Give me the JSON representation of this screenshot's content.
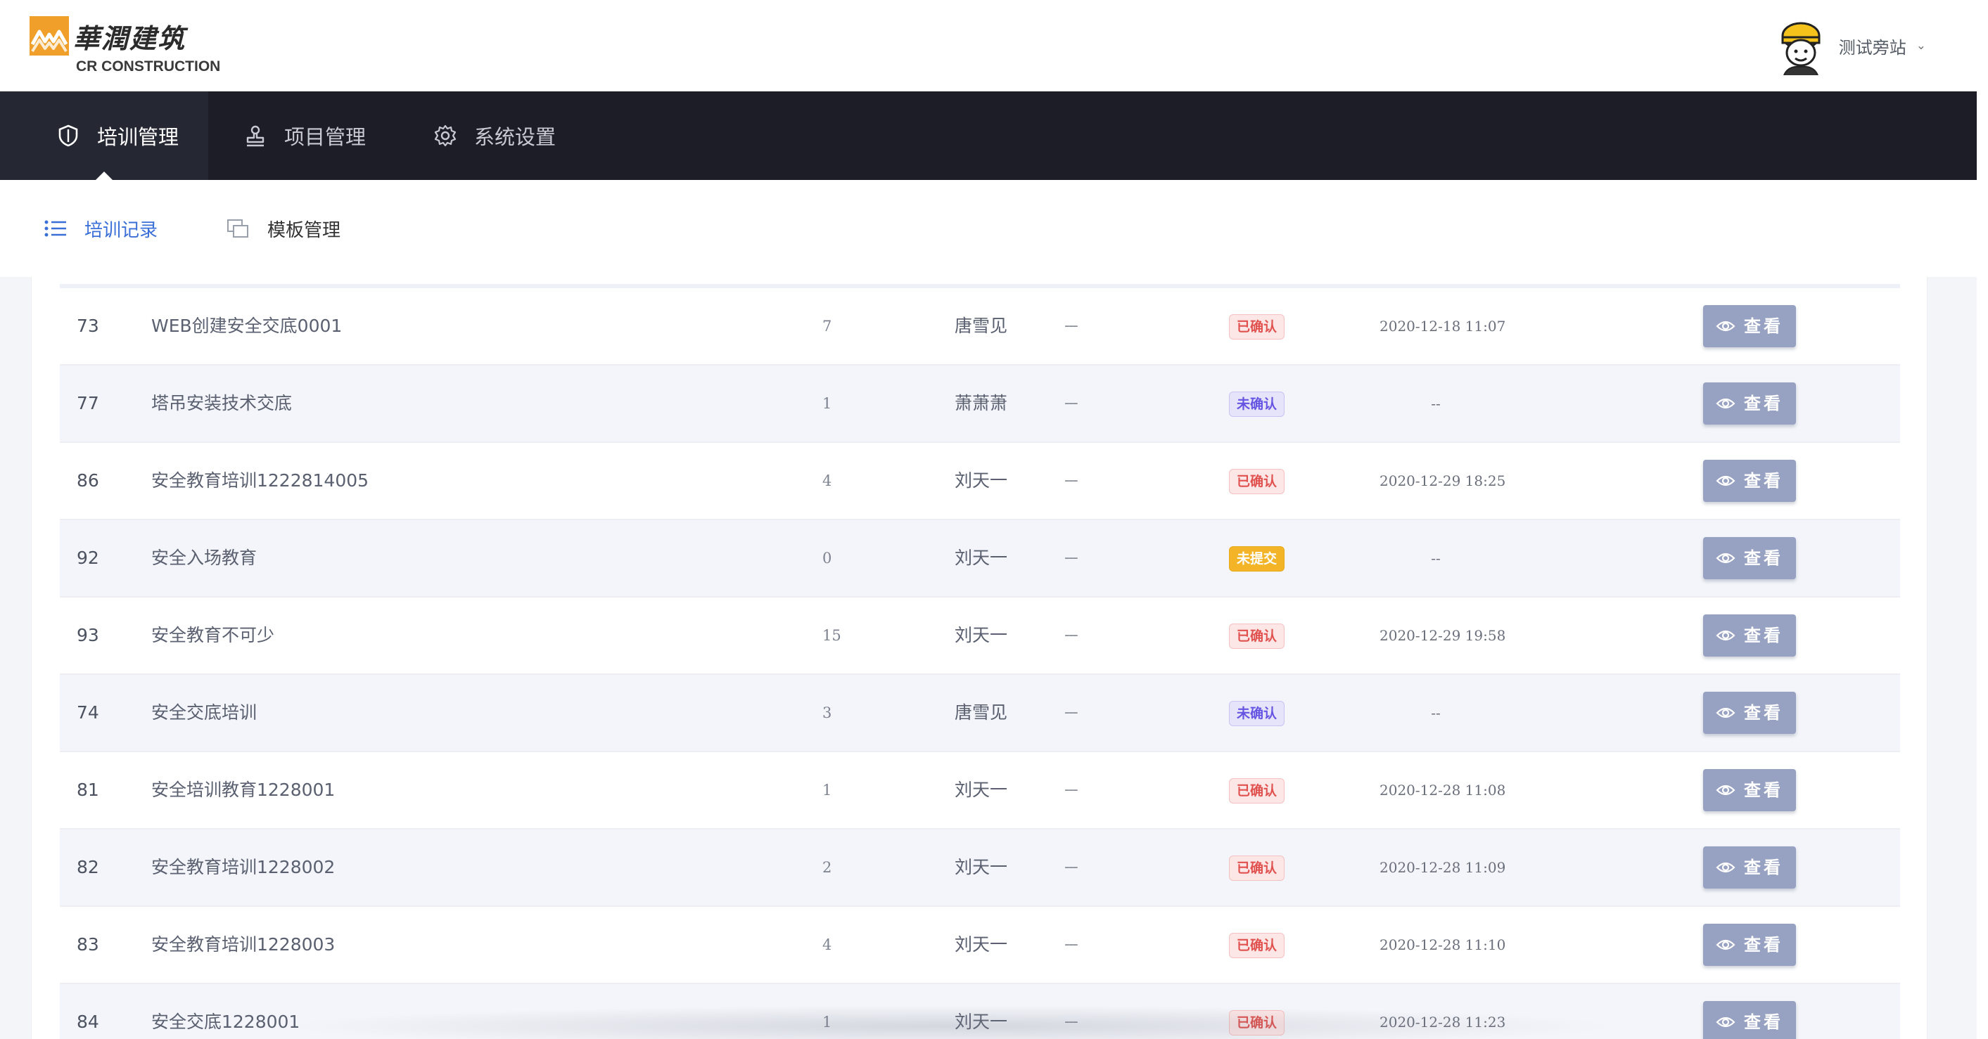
{
  "brand": {
    "name_cn": "華潤建筑",
    "name_en": "CR CONSTRUCTION",
    "color": "#f0a02a"
  },
  "user": {
    "name": "测试旁站",
    "caret": "⌄",
    "avatar_icon": "avatar-icon"
  },
  "main_nav": [
    {
      "label": "培训管理",
      "icon": "shield-icon",
      "active": true
    },
    {
      "label": "项目管理",
      "icon": "stamp-icon",
      "active": false
    },
    {
      "label": "系统设置",
      "icon": "gear-icon",
      "active": false
    }
  ],
  "sub_nav": [
    {
      "label": "培训记录",
      "icon": "list-icon",
      "active": true
    },
    {
      "label": "模板管理",
      "icon": "template-icon",
      "active": false
    }
  ],
  "colors": {
    "nav_bg": "#1c1d26",
    "accent": "#3b6fd8",
    "button": "#97a1c1"
  },
  "records": [
    {
      "id": "73",
      "name": "WEB创建安全交底0001",
      "count": "7",
      "person": "唐雪见",
      "extra": "---",
      "status": "已确认",
      "status_type": "red",
      "time": "2020-12-18 11:07",
      "action": "查看"
    },
    {
      "id": "77",
      "name": "塔吊安装技术交底",
      "count": "1",
      "person": "萧萧萧",
      "extra": "---",
      "status": "未确认",
      "status_type": "purple",
      "time": "--",
      "action": "查看"
    },
    {
      "id": "86",
      "name": "安全教育培训1222814005",
      "count": "4",
      "person": "刘天一",
      "extra": "---",
      "status": "已确认",
      "status_type": "red",
      "time": "2020-12-29 18:25",
      "action": "查看"
    },
    {
      "id": "92",
      "name": "安全入场教育",
      "count": "0",
      "person": "刘天一",
      "extra": "---",
      "status": "未提交",
      "status_type": "yellow",
      "time": "--",
      "action": "查看"
    },
    {
      "id": "93",
      "name": "安全教育不可少",
      "count": "15",
      "person": "刘天一",
      "extra": "---",
      "status": "已确认",
      "status_type": "red",
      "time": "2020-12-29 19:58",
      "action": "查看"
    },
    {
      "id": "74",
      "name": "安全交底培训",
      "count": "3",
      "person": "唐雪见",
      "extra": "---",
      "status": "未确认",
      "status_type": "purple",
      "time": "--",
      "action": "查看"
    },
    {
      "id": "81",
      "name": "安全培训教育1228001",
      "count": "1",
      "person": "刘天一",
      "extra": "---",
      "status": "已确认",
      "status_type": "red",
      "time": "2020-12-28 11:08",
      "action": "查看"
    },
    {
      "id": "82",
      "name": "安全教育培训1228002",
      "count": "2",
      "person": "刘天一",
      "extra": "---",
      "status": "已确认",
      "status_type": "red",
      "time": "2020-12-28 11:09",
      "action": "查看"
    },
    {
      "id": "83",
      "name": "安全教育培训1228003",
      "count": "4",
      "person": "刘天一",
      "extra": "---",
      "status": "已确认",
      "status_type": "red",
      "time": "2020-12-28 11:10",
      "action": "查看"
    },
    {
      "id": "84",
      "name": "安全交底1228001",
      "count": "1",
      "person": "刘天一",
      "extra": "---",
      "status": "已确认",
      "status_type": "red",
      "time": "2020-12-28 11:23",
      "action": "查看"
    }
  ]
}
